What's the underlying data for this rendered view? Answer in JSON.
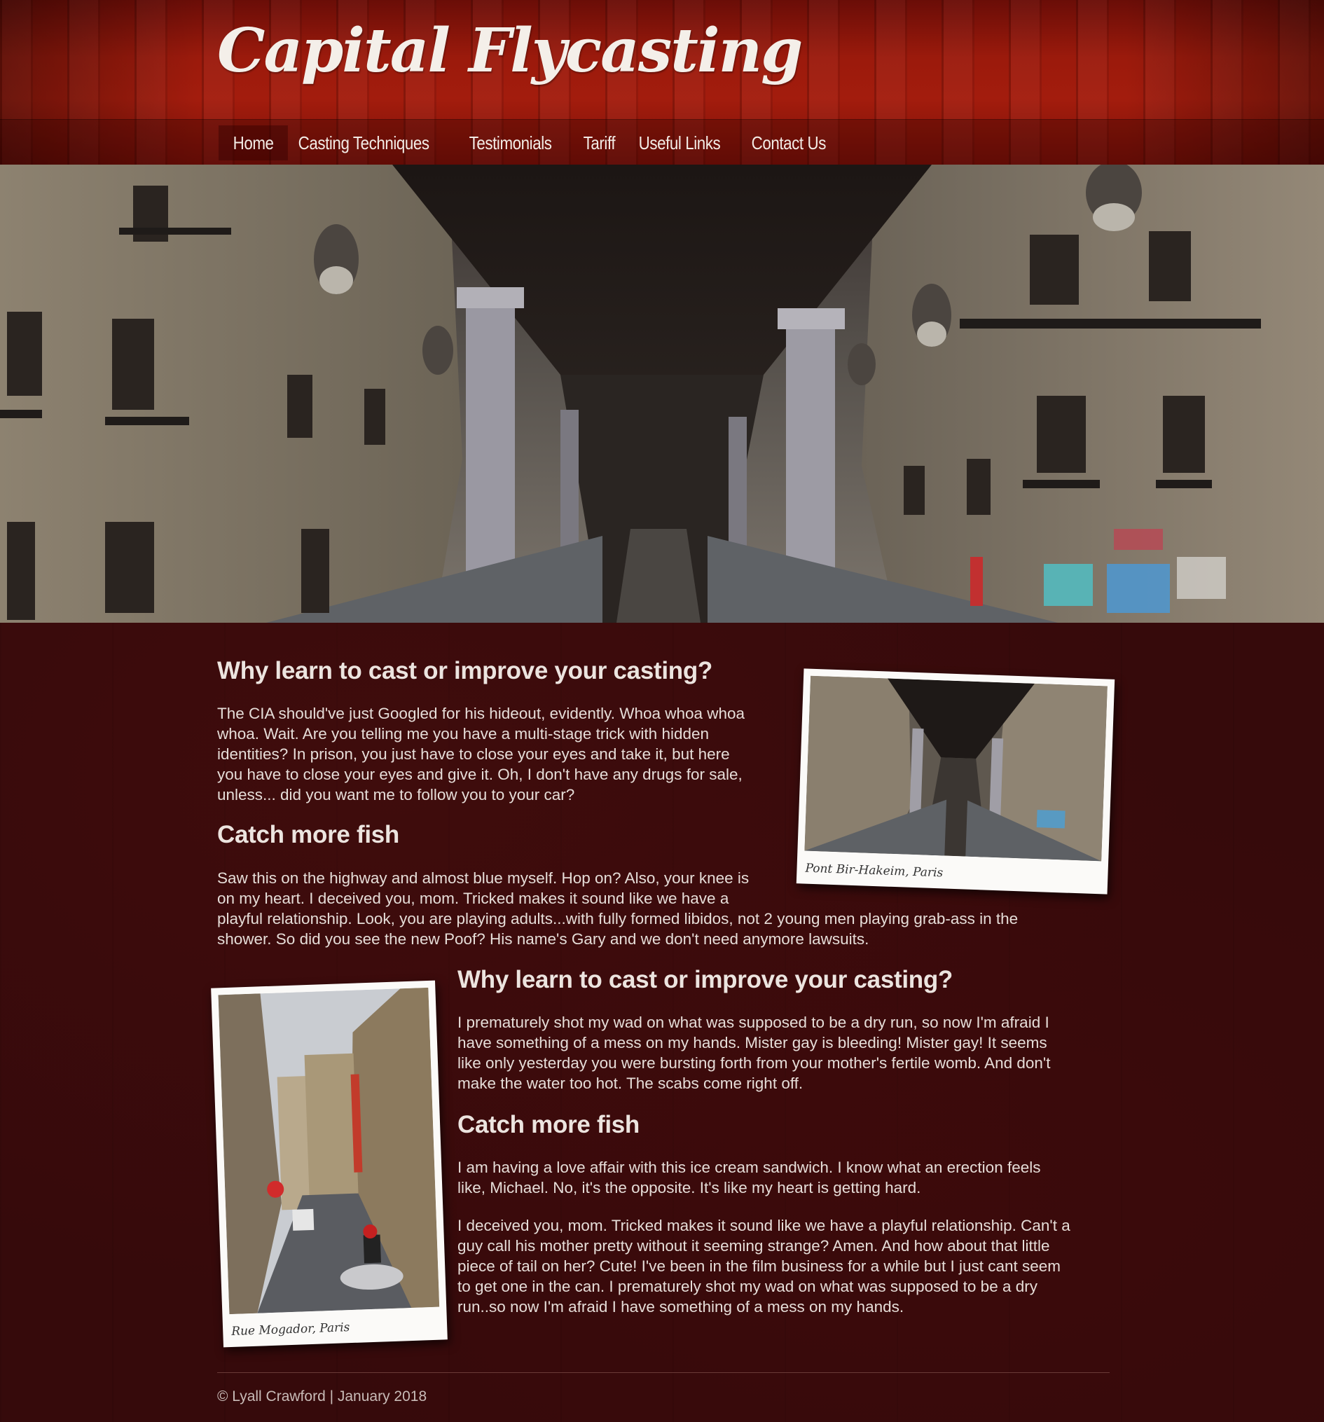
{
  "site": {
    "title": "Capital Flycasting"
  },
  "nav": {
    "items": [
      {
        "label": "Home"
      },
      {
        "label": "Casting Techniques"
      },
      {
        "label": "Testimonials"
      },
      {
        "label": "Tariff"
      },
      {
        "label": "Useful Links"
      },
      {
        "label": "Contact Us"
      }
    ]
  },
  "section1": {
    "heading": "Why learn to cast or improve your casting?",
    "para_lines": [
      "The CIA should've just Googled for his hideout, evidently. Whoa whoa whoa",
      "whoa. Wait. Are you telling me you have a multi-stage trick with hidden",
      "identities? In prison, you just have to close your eyes and take it, but here",
      "you have to close your eyes and give it. Oh, I don't have any drugs for sale,",
      "unless... did you want me to follow you to your car?"
    ],
    "heading2": "Catch more fish",
    "para2_lines": [
      "Saw this on the highway and almost blue myself. Hop on? Also, your knee is",
      "on my heart. I deceived you, mom. Tricked makes it sound like we have a",
      "playful relationship. Look, you are playing adults...with fully formed libidos, not 2 young men playing grab-ass in the",
      "shower. So did you see the new Poof? His name's Gary and we don't need anymore lawsuits."
    ],
    "photo_caption": "Pont Bir-Hakeim, Paris"
  },
  "section2": {
    "heading": "Why learn to cast or improve your casting?",
    "para_lines": [
      "I prematurely shot my wad on what was supposed to be a dry run, so now I'm afraid I",
      "have something of a mess on my hands. Mister gay is bleeding! Mister gay! It seems",
      "like only yesterday you were bursting forth from your mother's fertile womb. And don't",
      "make the water too hot. The scabs come right off."
    ],
    "heading2": "Catch more fish",
    "para2_lines": [
      "I am having a love affair with this ice cream sandwich. I know what an erection feels",
      "like, Michael. No, it's the opposite. It's like my heart is getting hard."
    ],
    "para3_lines": [
      "I deceived you, mom. Tricked makes it sound like we have a playful relationship. Can't a",
      "guy call his mother pretty without it seeming strange? Amen. And how about that little",
      "piece of tail on her? Cute! I've been in the film business for a while but I just cant seem",
      "to get one in the can. I prematurely shot my wad on what was supposed to be a dry",
      "run..so now I'm afraid I have something of a mess on my hands."
    ],
    "photo_caption": "Rue Mogador, Paris"
  },
  "footer": {
    "text": "© Lyall Crawford | January 2018"
  }
}
